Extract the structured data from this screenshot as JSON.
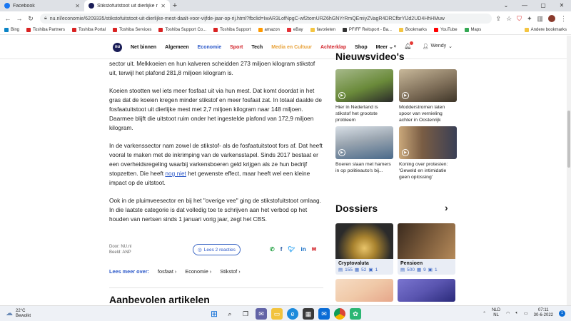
{
  "browser": {
    "tabs": [
      {
        "title": "Facebook",
        "favicon_color": "#1877f2",
        "active": false
      },
      {
        "title": "Stikstofuitstoot uit dierlijke mest daalt voor vijfde jaar op rij",
        "favicon_color": "#1a1d57",
        "active": true
      }
    ],
    "url": "nu.nl/economie/6209335/stikstofuitstoot-uit-dierlijke-mest-daalt-voor-vijfde-jaar-op-rij.html?fbclid=IwAR3LofNpgC-wf2tomURZ6hGNYrRmQEmiyZVagR4DRCfbrYlJd2UD4HhHMuw",
    "bookmarks": [
      {
        "label": "Bing",
        "color": "#0a84c6"
      },
      {
        "label": "Toshiba Partners",
        "color": "#d92222"
      },
      {
        "label": "Toshiba Portal",
        "color": "#d92222"
      },
      {
        "label": "Toshiba Services",
        "color": "#d92222"
      },
      {
        "label": "Toshiba Support Co...",
        "color": "#d92222"
      },
      {
        "label": "Toshiba Support",
        "color": "#d92222"
      },
      {
        "label": "amazon",
        "color": "#ff9900"
      },
      {
        "label": "eBay",
        "color": "#e53238"
      },
      {
        "label": "favorieten",
        "color": "#f4c542"
      },
      {
        "label": "PFIFF Reitsport - Ba...",
        "color": "#333333"
      },
      {
        "label": "Bookmarks",
        "color": "#f4c542"
      },
      {
        "label": "YouTube",
        "color": "#ff0000"
      },
      {
        "label": "Maps",
        "color": "#34a853"
      }
    ],
    "other_bookmarks": "Andere bookmarks"
  },
  "site": {
    "logo": "nu",
    "nav": [
      {
        "label": "Net binnen",
        "color": "#111111"
      },
      {
        "label": "Algemeen",
        "color": "#111111"
      },
      {
        "label": "Economie",
        "color": "#2a57c8"
      },
      {
        "label": "Sport",
        "color": "#d2232a"
      },
      {
        "label": "Tech",
        "color": "#111111"
      },
      {
        "label": "Media en Cultuur",
        "color": "#e8a23a"
      },
      {
        "label": "Achterklap",
        "color": "#d2232a"
      },
      {
        "label": "Shop",
        "color": "#111111"
      },
      {
        "label": "Meer",
        "color": "#111111"
      }
    ],
    "user": "Wendy"
  },
  "article": {
    "paragraphs": [
      {
        "text": "sector uit. Melkkoeien en hun kalveren scheidden 273 miljoen kilogram stikstof uit, terwijl het plafond 281,8 miljoen kilogram is."
      },
      {
        "text": "Koeien stootten wel iets meer fosfaat uit via hun mest. Dat komt doordat in het gras dat de koeien kregen minder stikstof en meer fosfaat zat. In totaal daalde de fosfaatuitstoot uit dierlijke mest met 2,7 miljoen kilogram naar 148 miljoen. Daarmee blijft die uitstoot ruim onder het ingestelde plafond van 172,9 miljoen kilogram."
      },
      {
        "text_before": "In de varkenssector nam zowel de stikstof- als de fosfaatuitstoot fors af. Dat heeft vooral te maken met de inkrimping van de varkensstapel. Sinds 2017 bestaat er een overheidsregeling waarbij varkensboeren geld krijgen als ze hun bedrijf stopzetten. Die heeft ",
        "link": "nog niet",
        "text_after": " het gewenste effect, maar heeft wel een kleine impact op de uitstoot."
      },
      {
        "text": "Ook in de pluimveesector en bij het \"overige vee\" ging de stikstofuitstoot omlaag. In die laatste categorie is dat volledig toe te schrijven aan het verbod op het houden van nertsen sinds 1 januari vorig jaar, zegt het CBS."
      }
    ],
    "meta_door": "Door: NU.nl",
    "meta_beeld": "Beeld: ANP",
    "reacties_label": "Lees 2 reacties",
    "lees_meer_label": "Lees meer over:",
    "tags": [
      "fosfaat",
      "Economie",
      "Stikstof"
    ],
    "aanbevolen_heading": "Aanbevolen artikelen"
  },
  "sidebar": {
    "videos_heading": "Nieuwsvideo's",
    "videos": [
      {
        "caption": "Hier in Nederland is stikstof het grootste probleem",
        "colors": [
          "#6a8a3a",
          "#2a2a2a"
        ]
      },
      {
        "caption": "Modderstromen laten spoor van vernieling achter in Oostenrijk",
        "colors": [
          "#7a6a55",
          "#c8b89a"
        ]
      },
      {
        "caption": "Boeren slaan met hamers in op politieauto's bij...",
        "colors": [
          "#4a6a8a",
          "#9aa5b0"
        ]
      },
      {
        "caption": "Koning over protesten: 'Geweld en intimidatie geen oplossing'",
        "colors": [
          "#3a3f55",
          "#c9a77a"
        ]
      }
    ],
    "dossiers_heading": "Dossiers",
    "dossiers": [
      {
        "name": "Cryptovaluta",
        "articles": "155",
        "videos": "52",
        "other": "1",
        "colors": [
          "#2b2b2b",
          "#c9a24a"
        ]
      },
      {
        "name": "Pensioen",
        "articles": "500",
        "videos": "9",
        "other": "1",
        "colors": [
          "#3a2a1e",
          "#b58a5a"
        ]
      },
      {
        "name": "",
        "articles": "",
        "videos": "",
        "other": "",
        "colors": [
          "#f0c9a8",
          "#e6a68a"
        ]
      },
      {
        "name": "",
        "articles": "",
        "videos": "",
        "other": "",
        "colors": [
          "#5a55b0",
          "#2a2a7a"
        ]
      }
    ]
  },
  "taskbar": {
    "temperature": "22°C",
    "weather_text": "Bewolkt",
    "lang_top": "NLD",
    "lang_bottom": "NL",
    "time": "07:11",
    "date": "30-6-2022"
  }
}
